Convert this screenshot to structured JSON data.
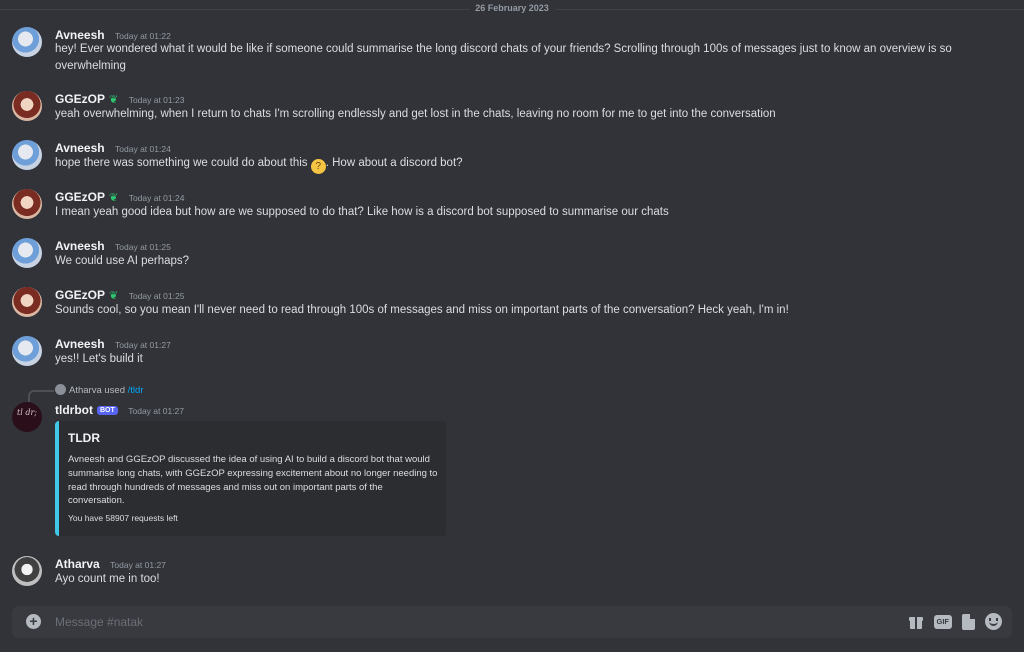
{
  "date_divider": "26 February 2023",
  "messages": [
    {
      "author": "Avneesh",
      "time": "Today at 01:22",
      "text": "hey! Ever wondered what it would be like if someone could summarise the long discord chats of your friends? Scrolling through 100s of messages just to know an overview is so overwhelming"
    },
    {
      "author": "GGEzOP",
      "time": "Today at 01:23",
      "text": "yeah overwhelming, when I return to chats I'm scrolling endlessly and get lost in the chats, leaving no room for me to get into the conversation"
    },
    {
      "author": "Avneesh",
      "time": "Today at 01:24",
      "text_before": "hope there was something we could do about this",
      "text_after": ". How about a discord bot?"
    },
    {
      "author": "GGEzOP",
      "time": "Today at 01:24",
      "text": "I mean yeah good idea but how are we supposed to do that? Like how is a discord bot supposed to summarise our chats"
    },
    {
      "author": "Avneesh",
      "time": "Today at 01:25",
      "text": "We could use AI perhaps?"
    },
    {
      "author": "GGEzOP",
      "time": "Today at 01:25",
      "text": "Sounds cool, so you mean I'll never need to read through 100s of messages and miss on important parts of the conversation? Heck yeah, I'm in!"
    },
    {
      "author": "Avneesh",
      "time": "Today at 01:27",
      "text": "yes!! Let's build it"
    }
  ],
  "bot_message": {
    "used_by": "Atharva",
    "used_word": "used",
    "command": "/tldr",
    "author": "tldrbot",
    "tag": "BOT",
    "avatar_text": "tl dr;",
    "time": "Today at 01:27",
    "embed": {
      "title": "TLDR",
      "description": "Avneesh and GGEzOP discussed the idea of using AI to build a discord bot that would summarise long chats, with GGEzOP expressing excitement about no longer needing to read through hundreds of messages and miss out on important parts of the conversation.",
      "footer": "You have 58907 requests left",
      "accent_color": "#41c8e6"
    }
  },
  "last_message": {
    "author": "Atharva",
    "time": "Today at 01:27",
    "text": "Ayo count me in too!"
  },
  "composer": {
    "placeholder": "Message #natak",
    "gif_label": "GIF",
    "icons": [
      "add-icon",
      "gift-icon",
      "gif-icon",
      "sticker-icon",
      "emoji-icon"
    ]
  },
  "colors": {
    "background": "#313338",
    "composer": "#383a40",
    "bot_tag": "#5865f2",
    "link": "#00a8fc"
  }
}
